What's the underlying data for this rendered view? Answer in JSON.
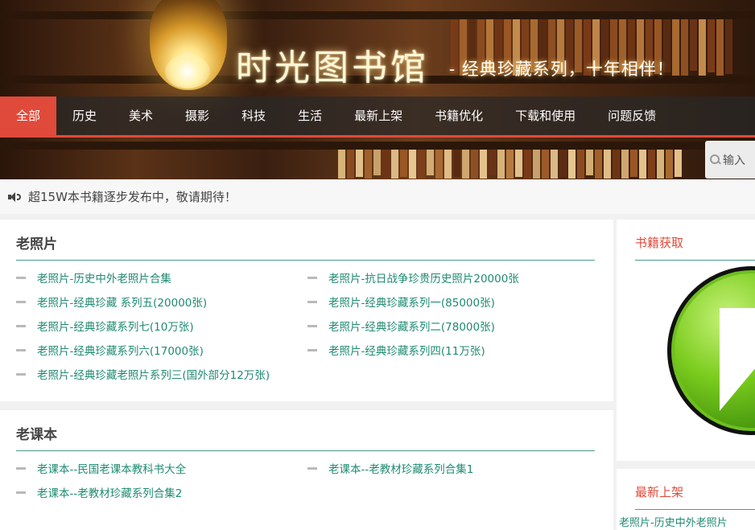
{
  "header": {
    "site_title": "时光图书馆",
    "slogan": "- 经典珍藏系列，十年相伴！"
  },
  "nav": {
    "items": [
      "全部",
      "历史",
      "美术",
      "摄影",
      "科技",
      "生活",
      "最新上架",
      "书籍优化",
      "下载和使用",
      "问题反馈"
    ],
    "active_index": 0
  },
  "search": {
    "placeholder": "输入"
  },
  "notice": {
    "text": "超15W本书籍逐步发布中，敬请期待！"
  },
  "sections": [
    {
      "title": "老照片",
      "links": [
        "老照片-历史中外老照片合集",
        "老照片-抗日战争珍贵历史照片20000张",
        "老照片-经典珍藏 系列五(20000张)",
        "老照片-经典珍藏系列一(85000张)",
        "老照片-经典珍藏系列七(10万张)",
        "老照片-经典珍藏系列二(78000张)",
        "老照片-经典珍藏系列六(17000张)",
        "老照片-经典珍藏系列四(11万张)",
        "老照片-经典珍藏老照片系列三(国外部分12万张)"
      ]
    },
    {
      "title": "老课本",
      "links": [
        "老课本--民国老课本教科书大全",
        "老课本--老教材珍藏系列合集1",
        "老课本--老教材珍藏系列合集2"
      ]
    }
  ],
  "sidebar": {
    "download_title": "书籍获取",
    "latest_title": "最新上架",
    "latest_first_link": "老照片-历史中外老照片"
  },
  "colors": {
    "accent": "#e04a3a",
    "link": "#1f8a72",
    "rule": "#4a9a8f"
  }
}
